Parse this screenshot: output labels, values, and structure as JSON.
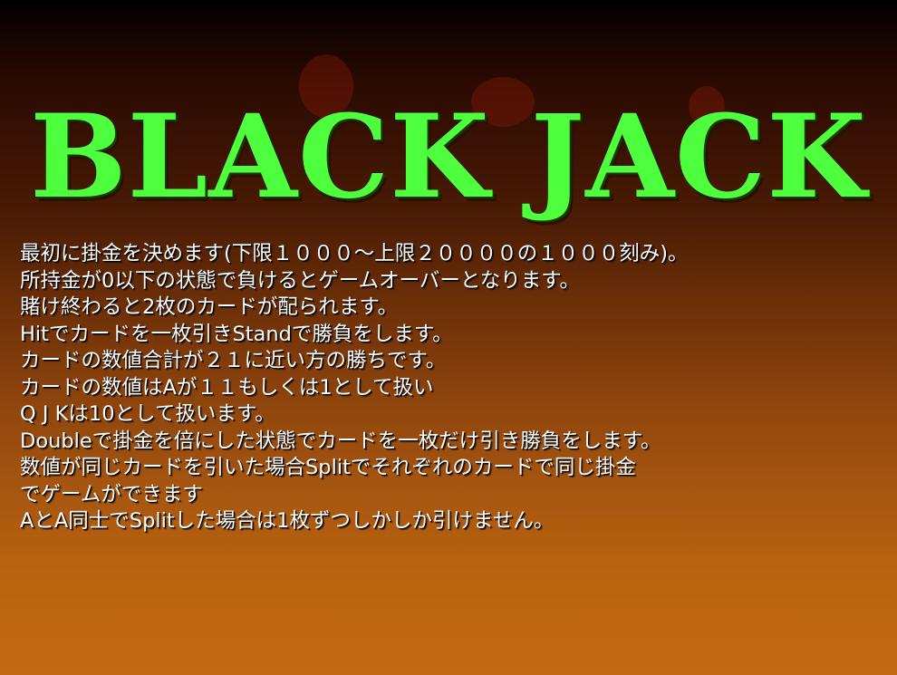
{
  "title": "BLACK JACK",
  "rules": [
    "最初に掛金を決めます(下限１０００～上限２００００の１０００刻み)。",
    "所持金が0以下の状態で負けるとゲームオーバーとなります。",
    "賭け終わると2枚のカードが配られます。",
    "Hitでカードを一枚引きStandで勝負をします。",
    "カードの数値合計が２１に近い方の勝ちです。",
    "カードの数値はAが１１もしくは1として扱い",
    "Q J Kは10として扱います。",
    "Doubleで掛金を倍にした状態でカードを一枚だけ引き勝負をします。",
    "数値が同じカードを引いた場合Splitでそれぞれのカードで同じ掛金",
    "でゲームができます",
    "AとA同士でSplitした場合は1枚ずつしかしか引けません。"
  ],
  "colors": {
    "title": "#4dff3c",
    "text": "#ffffff",
    "background_top": "#000000",
    "background_bottom": "#c26a12"
  }
}
